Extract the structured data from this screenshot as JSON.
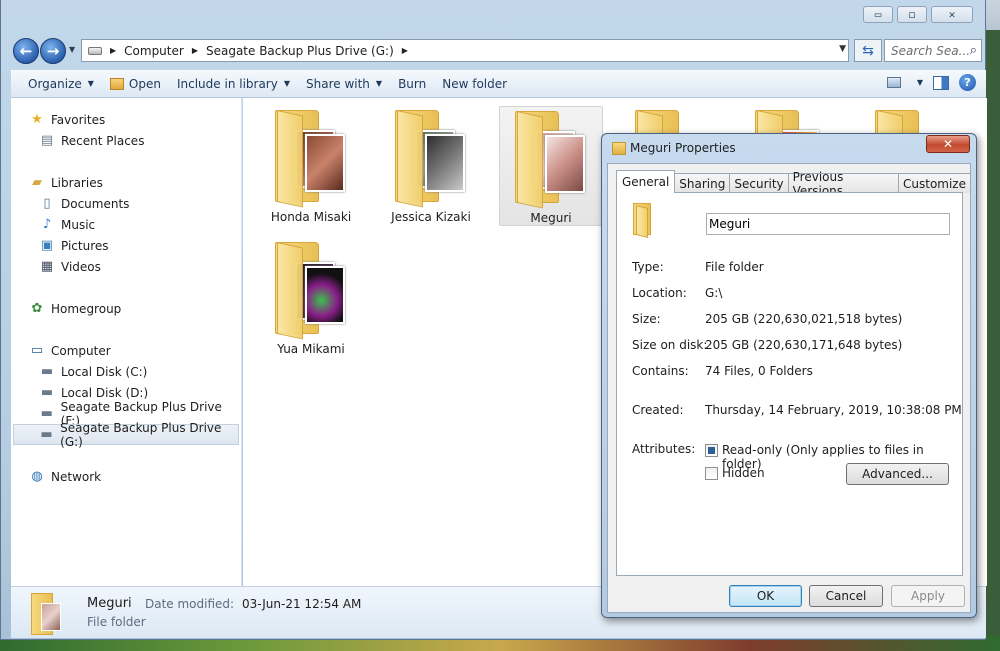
{
  "explorer": {
    "window_controls": {
      "minimize": "▭",
      "maximize": "◻",
      "close": "✕"
    },
    "breadcrumb": [
      "Computer",
      "Seagate Backup Plus Drive (G:)"
    ],
    "search_placeholder": "Search Sea...",
    "toolbar": {
      "organize": "Organize",
      "open": "Open",
      "include_in_library": "Include in library",
      "share_with": "Share with",
      "burn": "Burn",
      "new_folder": "New folder"
    },
    "nav": {
      "favorites": "Favorites",
      "recent_places": "Recent Places",
      "libraries": "Libraries",
      "documents": "Documents",
      "music": "Music",
      "pictures": "Pictures",
      "videos": "Videos",
      "homegroup": "Homegroup",
      "computer": "Computer",
      "local_c": "Local Disk (C:)",
      "local_d": "Local Disk (D:)",
      "seagate_f": "Seagate Backup Plus Drive (F:)",
      "seagate_g": "Seagate Backup Plus Drive (G:)",
      "network": "Network"
    },
    "folders": [
      {
        "label": "Honda Misaki"
      },
      {
        "label": "Jessica Kizaki"
      },
      {
        "label": "Meguri"
      },
      {
        "label": "Yua Mikami"
      }
    ],
    "details": {
      "name": "Meguri",
      "modified_label": "Date modified:",
      "modified_value": "03-Jun-21 12:54 AM",
      "type": "File folder"
    }
  },
  "dialog": {
    "title": "Meguri Properties",
    "close": "✕",
    "tabs": [
      "General",
      "Sharing",
      "Security",
      "Previous Versions",
      "Customize"
    ],
    "active_tab": "General",
    "name_value": "Meguri",
    "props": {
      "type_label": "Type:",
      "type_value": "File folder",
      "location_label": "Location:",
      "location_value": "G:\\",
      "size_label": "Size:",
      "size_value": "205 GB (220,630,021,518 bytes)",
      "size_on_disk_label": "Size on disk:",
      "size_on_disk_value": "205 GB (220,630,171,648 bytes)",
      "contains_label": "Contains:",
      "contains_value": "74 Files, 0 Folders",
      "created_label": "Created:",
      "created_value": "Thursday, 14 February, 2019, 10:38:08 PM",
      "attributes_label": "Attributes:",
      "readonly_label": "Read-only (Only applies to files in folder)",
      "readonly_state": "indeterminate",
      "hidden_label": "Hidden",
      "hidden_checked": false,
      "advanced_button": "Advanced..."
    },
    "buttons": {
      "ok": "OK",
      "cancel": "Cancel",
      "apply": "Apply"
    }
  }
}
